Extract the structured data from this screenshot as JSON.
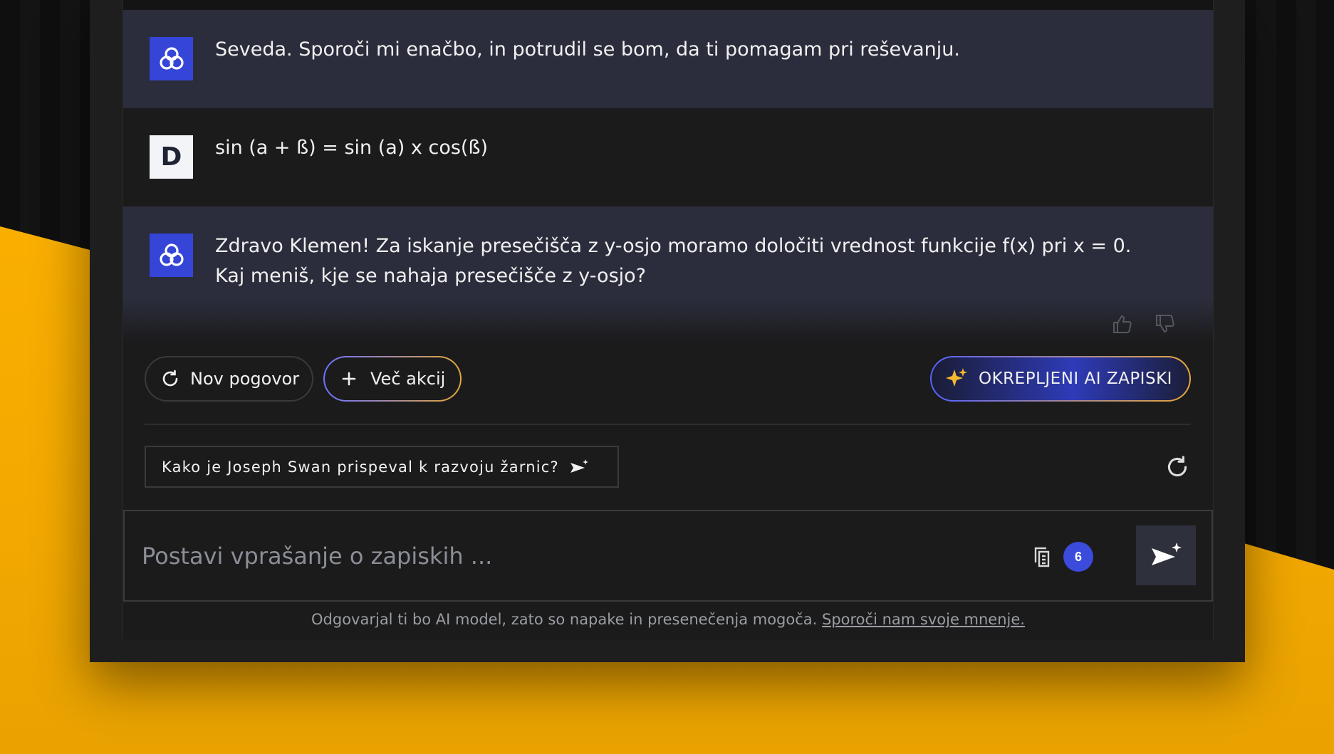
{
  "messages": [
    {
      "role": "ai",
      "text": "Seveda. Sporoči mi enačbo, in potrudil se bom, da ti pomagam pri reševanju."
    },
    {
      "role": "user",
      "avatar_letter": "D",
      "text": "sin (a + ß) = sin (a) x cos(ß)"
    },
    {
      "role": "ai",
      "text": "Zdravo Klemen! Za iskanje presečišča z y-osjo moramo določiti vrednost funkcije f(x) pri x = 0. Kaj meniš, kje se nahaja presečišče z y-osjo?"
    }
  ],
  "actions": {
    "new_chat": "Nov pogovor",
    "more_actions": "Več akcij",
    "enhanced_notes": "OKREPLJENI AI ZAPISKI"
  },
  "suggestion": "Kako je Joseph Swan prispeval k razvoju žarnic?",
  "input": {
    "placeholder": "Postavi vprašanje o zapiskih ...",
    "value": ""
  },
  "notes_count": "6",
  "footer": {
    "text": "Odgovarjal ti bo AI model, zato so napake in presenečenja mogoča. ",
    "link": "Sporoči nam svoje mnenje."
  },
  "colors": {
    "accent": "#3545d8",
    "background_yellow": "#ffb400",
    "panel": "#1b1b1c",
    "ai_message_bg": "#2b2d3c"
  },
  "icons": {
    "ai_avatar": "knot-logo-icon",
    "thumbs_up": "thumbs-up-icon",
    "thumbs_down": "thumbs-down-icon",
    "new_chat": "refresh-icon",
    "more": "plus-icon",
    "notes": "sparkles-icon",
    "suggest_send": "send-sparkle-icon",
    "refresh_suggestions": "refresh-icon",
    "documents": "documents-icon",
    "send": "send-sparkle-icon"
  }
}
